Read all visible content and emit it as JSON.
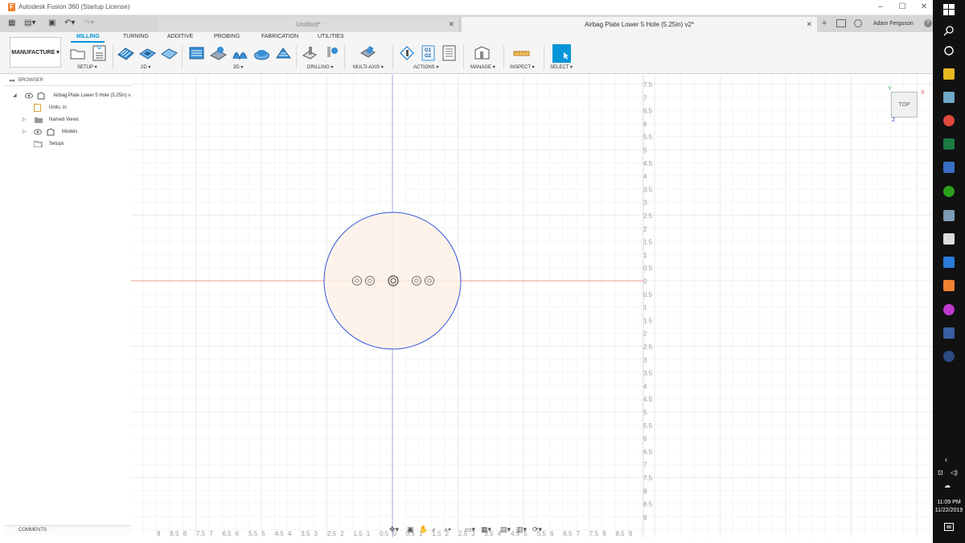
{
  "window": {
    "title": "Autodesk Fusion 360 (Startup License)",
    "minimize_icon": "minimize-icon",
    "maximize_icon": "maximize-icon",
    "close_icon": "close-icon"
  },
  "tabs": [
    {
      "label": "Untitled*",
      "active": false
    },
    {
      "label": "Airbag Plate Lower 5 Hole (5.25in) v2*",
      "active": true
    }
  ],
  "user": {
    "name": "Adam Ferguson"
  },
  "workspace": {
    "label": "MANUFACTURE ▾"
  },
  "ribbon_tabs": [
    "MILLING",
    "TURNING",
    "ADDITIVE",
    "PROBING",
    "FABRICATION",
    "UTILITIES"
  ],
  "ribbon_groups": {
    "setup": "SETUP ▾",
    "twod": "2D ▾",
    "threed": "3D ▾",
    "drilling": "DRILLING ▾",
    "multiaxis": "MULTI-AXIS ▾",
    "actions": "ACTIONS ▾",
    "manage": "MANAGE ▾",
    "inspect": "INSPECT ▾",
    "select": "SELECT ▾"
  },
  "actions_labels": {
    "g1": "G1",
    "g2": "G2",
    "g": "G"
  },
  "browser": {
    "title": "BROWSER",
    "root": "Airbag Plate Lower 5 Hole (5.25in) v1",
    "units": "Units: in",
    "named_views": "Named Views",
    "models": "Models",
    "setups": "Setups"
  },
  "comments": {
    "label": "COMMENTS"
  },
  "viewcube": {
    "face": "TOP",
    "x_label": "X",
    "y_label": "Y",
    "z_label": "Z"
  },
  "ruler": {
    "right": [
      "7.5",
      "7",
      "6.5",
      "6",
      "5.5",
      "5",
      "4.5",
      "4",
      "3.5",
      "3",
      "2.5",
      "2",
      "1.5",
      "1",
      "0.5",
      "0",
      "0.5",
      "1",
      "1.5",
      "2",
      "2.5",
      "3",
      "3.5",
      "4",
      "4.5",
      "5",
      "5.5",
      "6",
      "6.5",
      "7",
      "7.5",
      "8",
      "8.5",
      "9"
    ],
    "bottom": [
      "9",
      "8.5",
      "8",
      "7.5",
      "7",
      "6.5",
      "6",
      "5.5",
      "5",
      "4.5",
      "4",
      "3.5",
      "3",
      "2.5",
      "2",
      "1.5",
      "1",
      "0.5",
      "0",
      "0.5",
      "1",
      "1.5",
      "2",
      "2.5",
      "3",
      "3.5",
      "4",
      "4.5",
      "5",
      "5.5",
      "6",
      "6.5",
      "7",
      "7.5",
      "8",
      "8.5",
      "9"
    ]
  },
  "taskbar": {
    "time": "11:09 PM",
    "date": "11/22/2019"
  },
  "colors": {
    "accent": "#0696d7",
    "part_fill": "#fdf1e6",
    "part_edge": "#3355dd",
    "x_axis": "#f08070",
    "y_axis": "#7a8fe0"
  }
}
